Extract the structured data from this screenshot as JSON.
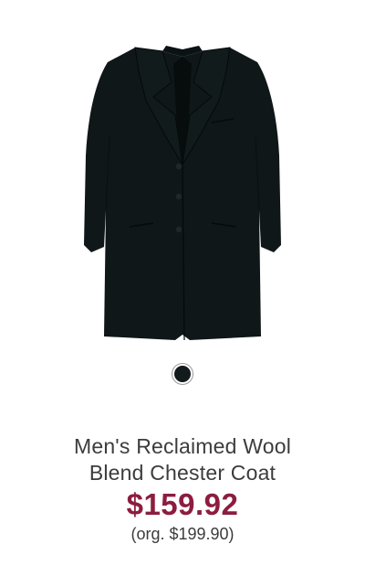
{
  "product": {
    "title_line1": "Men's Reclaimed Wool",
    "title_line2": "Blend Chester Coat",
    "price": "$159.92",
    "original_price": "(org. $199.90)",
    "image_icon": "coat-image",
    "swatches": [
      {
        "color": "#121a1c",
        "selected": true
      }
    ]
  },
  "colors": {
    "price": "#8c1d3f",
    "text": "#3c3c3c",
    "coat": "#0f1718"
  }
}
